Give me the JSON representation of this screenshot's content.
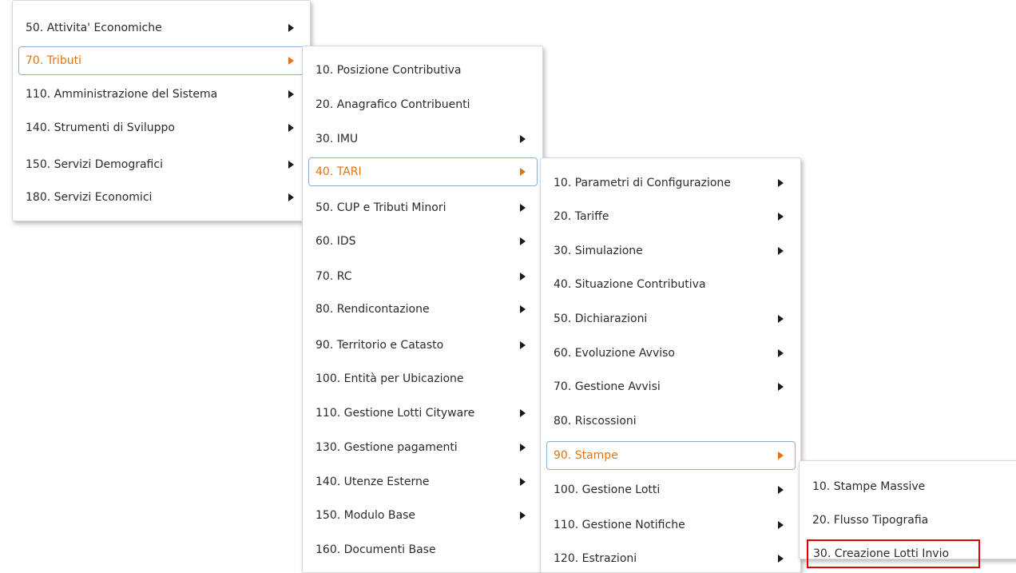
{
  "menus": {
    "level1": {
      "items": [
        {
          "label": "50. Attivita' Economiche",
          "has_submenu": true
        },
        {
          "label": "70. Tributi",
          "has_submenu": true,
          "active": true
        },
        {
          "label": "110. Amministrazione del Sistema",
          "has_submenu": true
        },
        {
          "label": "140. Strumenti di Sviluppo",
          "has_submenu": true
        },
        {
          "label": "150. Servizi Demografici",
          "has_submenu": true
        },
        {
          "label": "180. Servizi Economici",
          "has_submenu": true
        }
      ]
    },
    "level2": {
      "items": [
        {
          "label": "10. Posizione Contributiva",
          "has_submenu": false
        },
        {
          "label": "20. Anagrafico Contribuenti",
          "has_submenu": false
        },
        {
          "label": "30. IMU",
          "has_submenu": true
        },
        {
          "label": "40. TARI",
          "has_submenu": true,
          "active": true
        },
        {
          "label": "50. CUP e Tributi Minori",
          "has_submenu": true
        },
        {
          "label": "60. IDS",
          "has_submenu": true
        },
        {
          "label": "70. RC",
          "has_submenu": true
        },
        {
          "label": "80. Rendicontazione",
          "has_submenu": true
        },
        {
          "label": "90. Territorio e Catasto",
          "has_submenu": true
        },
        {
          "label": "100. Entità per Ubicazione",
          "has_submenu": false
        },
        {
          "label": "110. Gestione Lotti Cityware",
          "has_submenu": true
        },
        {
          "label": "130. Gestione pagamenti",
          "has_submenu": true
        },
        {
          "label": "140. Utenze Esterne",
          "has_submenu": true
        },
        {
          "label": "150. Modulo Base",
          "has_submenu": true
        },
        {
          "label": "160. Documenti Base",
          "has_submenu": false
        }
      ]
    },
    "level3": {
      "items": [
        {
          "label": "10. Parametri di Configurazione",
          "has_submenu": true
        },
        {
          "label": "20. Tariffe",
          "has_submenu": true
        },
        {
          "label": "30. Simulazione",
          "has_submenu": true
        },
        {
          "label": "40. Situazione Contributiva",
          "has_submenu": false
        },
        {
          "label": "50. Dichiarazioni",
          "has_submenu": true
        },
        {
          "label": "60. Evoluzione Avviso",
          "has_submenu": true
        },
        {
          "label": "70. Gestione Avvisi",
          "has_submenu": true
        },
        {
          "label": "80. Riscossioni",
          "has_submenu": false
        },
        {
          "label": "90. Stampe",
          "has_submenu": true,
          "active": true
        },
        {
          "label": "100. Gestione Lotti",
          "has_submenu": true
        },
        {
          "label": "110. Gestione Notifiche",
          "has_submenu": true
        },
        {
          "label": "120. Estrazioni",
          "has_submenu": true
        }
      ]
    },
    "level4": {
      "items": [
        {
          "label": "10. Stampe Massive",
          "has_submenu": false
        },
        {
          "label": "20. Flusso Tipografia",
          "has_submenu": false
        },
        {
          "label": "30. Creazione Lotti Invio",
          "has_submenu": false,
          "highlighted": true
        }
      ]
    }
  },
  "colors": {
    "active_text": "#e4730f",
    "active_border": "#8ab2d6",
    "highlight_border": "#e00000"
  }
}
